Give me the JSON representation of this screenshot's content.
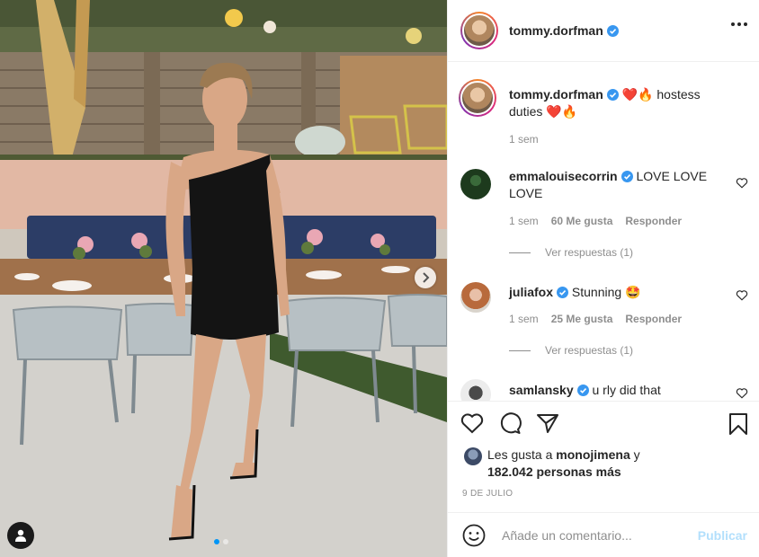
{
  "header": {
    "username": "tommy.dorfman",
    "more_icon": "more-horizontal-icon"
  },
  "caption": {
    "username": "tommy.dorfman",
    "text": "❤️🔥 hostess duties ❤️🔥",
    "time": "1 sem"
  },
  "comments": [
    {
      "username": "emmalouisecorrin",
      "text": "LOVE LOVE LOVE",
      "time": "1 sem",
      "likes": "60 Me gusta",
      "reply": "Responder",
      "view_replies": "Ver respuestas (1)"
    },
    {
      "username": "juliafox",
      "text": "Stunning 🤩",
      "time": "1 sem",
      "likes": "25 Me gusta",
      "reply": "Responder",
      "view_replies": "Ver respuestas (1)"
    },
    {
      "username": "samlansky",
      "text": "u rly did that"
    }
  ],
  "likes": {
    "prefix": "Les gusta a",
    "user": "monojimena",
    "connector": "y",
    "others": "182.042 personas más"
  },
  "date": "9 DE JULIO",
  "composer": {
    "placeholder": "Añade un comentario...",
    "publish_label": "Publicar"
  },
  "colors": {
    "link_blue": "#0095f6",
    "publish_disabled": "#b2dffc",
    "muted": "#8e8e8e"
  }
}
